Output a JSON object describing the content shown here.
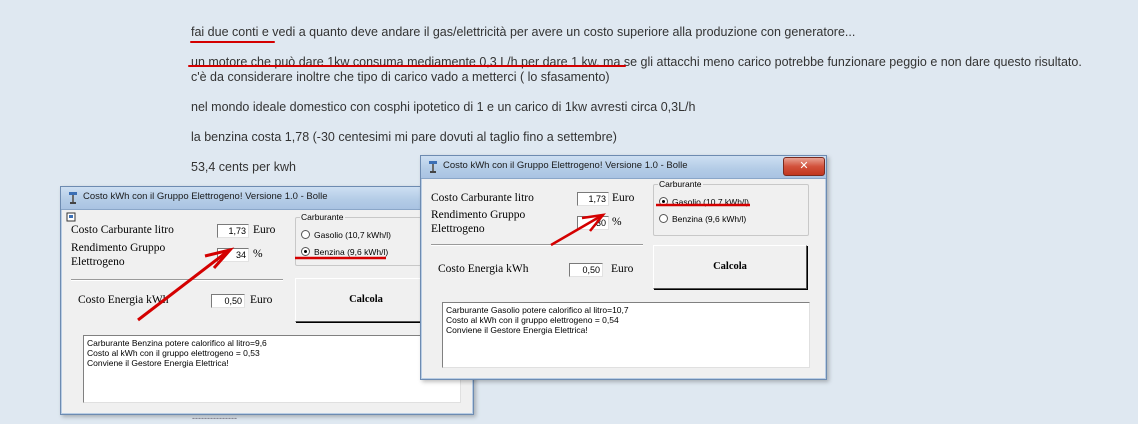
{
  "post": {
    "lines": [
      "fai due conti e vedi a quanto deve andare il gas/elettricità per avere un costo superiore alla produzione con generatore...",
      "un motore che può dare 1kw consuma mediamente 0,3 L/h per dare 1 kw. ma se gli attacchi meno carico potrebbe funzionare peggio e non dare questo risultato.",
      "c'è da considerare inoltre che tipo di carico vado a metterci ( lo sfasamento)",
      "nel mondo ideale domestico con cosphi ipotetico di 1 e un carico di 1kw avresti circa 0,3L/h",
      "la benzina costa 1,78 (-30 centesimi mi pare dovuti al taglio fino a settembre)",
      "53,4 cents per kwh"
    ],
    "footer_dashes": "---------------"
  },
  "colors": {
    "annotation_red": "#d40000",
    "window_background": "#f0f0f0",
    "page_background": "#dfe8f1"
  },
  "window_left": {
    "title": "Costo kWh con il Gruppo Elettrogeno! Versione 1.0 - Bolle",
    "fuel_cost_label": "Costo Carburante litro",
    "fuel_cost_value": "1,73",
    "fuel_cost_unit": "Euro",
    "efficiency_label_1": "Rendimento Gruppo",
    "efficiency_label_2": "Elettrogeno",
    "efficiency_value": "34",
    "efficiency_unit": "%",
    "energy_cost_label": "Costo Energia kWh",
    "energy_cost_value": "0,50",
    "energy_cost_unit": "Euro",
    "fuel_group_label": "Carburante",
    "option_diesel": "Gasolio (10,7  kWh/l)",
    "option_petrol": "Benzina (9,6  kWh/l)",
    "selected": "petrol",
    "calc_button": "Calcola",
    "result_lines": [
      "Carburante Benzina potere calorifico al litro=9,6",
      "Costo al kWh con il gruppo elettrogeno = 0,53",
      "Conviene il Gestore Energia Elettrica!"
    ]
  },
  "window_right": {
    "title": "Costo kWh con il Gruppo Elettrogeno! Versione 1.0 - Bolle",
    "close_glyph": "✕",
    "fuel_cost_label": "Costo Carburante litro",
    "fuel_cost_value": "1,73",
    "fuel_cost_unit": "Euro",
    "efficiency_label_1": "Rendimento Gruppo",
    "efficiency_label_2": "Elettrogeno",
    "efficiency_value": "30",
    "efficiency_unit": "%",
    "energy_cost_label": "Costo Energia kWh",
    "energy_cost_value": "0,50",
    "energy_cost_unit": "Euro",
    "fuel_group_label": "Carburante",
    "option_diesel": "Gasolio (10,7  kWh/l)",
    "option_petrol": "Benzina (9,6  kWh/l)",
    "selected": "diesel",
    "calc_button": "Calcola",
    "result_lines": [
      "Carburante Gasolio potere calorifico al litro=10,7",
      "Costo al kWh con il gruppo elettrogeno = 0,54",
      "Conviene il Gestore Energia Elettrica!"
    ]
  }
}
